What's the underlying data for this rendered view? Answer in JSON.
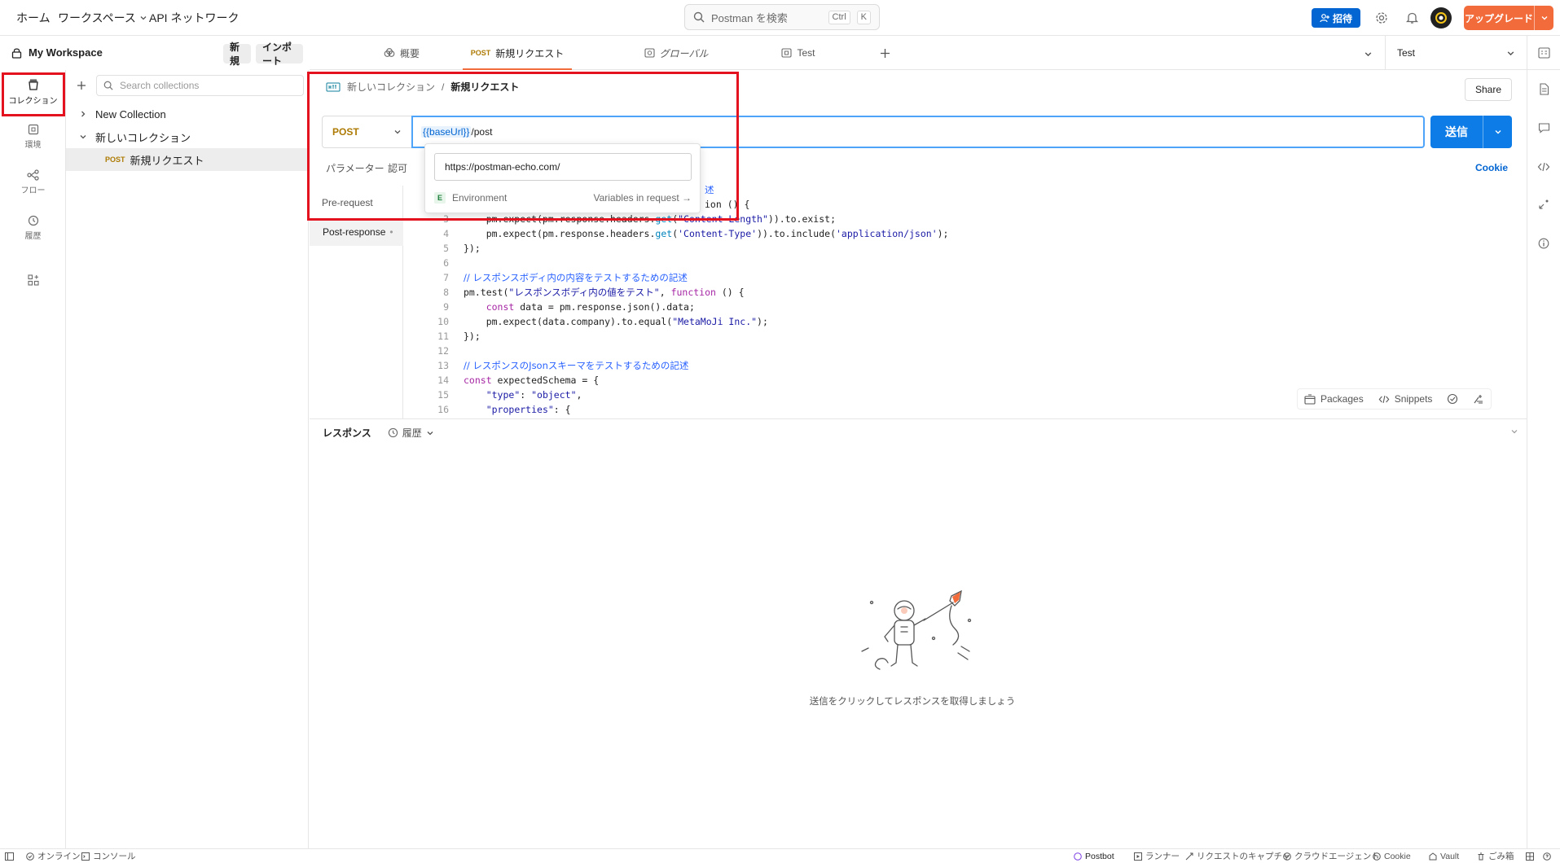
{
  "topbar": {
    "home": "ホーム",
    "workspaces": "ワークスペース",
    "api_network": "API ネットワーク",
    "search_placeholder": "Postman を検索",
    "kbd_ctrl": "Ctrl",
    "kbd_k": "K",
    "invite": "招待",
    "upgrade": "アップグレード"
  },
  "workspace": {
    "name": "My Workspace",
    "new_button": "新規",
    "import_button": "インポート"
  },
  "rail": {
    "items": [
      {
        "label": "コレクション",
        "icon": "collections-icon",
        "active": true
      },
      {
        "label": "環境",
        "icon": "environments-icon"
      },
      {
        "label": "フロー",
        "icon": "flows-icon"
      },
      {
        "label": "履歴",
        "icon": "history-icon"
      },
      {
        "label": "",
        "icon": "add-apps-icon"
      }
    ]
  },
  "collections": {
    "search_placeholder": "Search collections",
    "tree": [
      {
        "label": "New Collection",
        "expanded": false
      },
      {
        "label": "新しいコレクション",
        "expanded": true
      },
      {
        "method": "POST",
        "label": "新規リクエスト",
        "selected": true
      }
    ]
  },
  "tabs": [
    {
      "label": "概要",
      "icon": "overview-icon"
    },
    {
      "method": "POST",
      "label": "新規リクエスト",
      "active": true
    },
    {
      "label": "グローバル",
      "icon": "globals-icon"
    },
    {
      "label": "Test",
      "icon": "environment-tab-icon"
    }
  ],
  "environment_selector": "Test",
  "request": {
    "breadcrumb_parent": "新しいコレクション",
    "breadcrumb_sep": "/",
    "breadcrumb_current": "新規リクエスト",
    "share": "Share",
    "method": "POST",
    "url_var": "{{baseUrl}}",
    "url_path": "/post",
    "send": "送信",
    "tabs": [
      "パラメーター",
      "認可"
    ],
    "cookie": "Cookie"
  },
  "variable_popup": {
    "value": "https://postman-echo.com/",
    "env_badge": "E",
    "env_label": "Environment",
    "link": "Variables in request →"
  },
  "scripts": {
    "items": [
      {
        "label": "Pre-request"
      },
      {
        "label": "Post-response",
        "dot": "•",
        "selected": true
      }
    ],
    "lines": [
      {
        "n": "3",
        "text": "    pm.expect(pm.response.headers.get(\"Content-Length\")).to.exist;"
      },
      {
        "n": "4",
        "text": "    pm.expect(pm.response.headers.get('Content-Type')).to.include('application/json');"
      },
      {
        "n": "5",
        "text": "});"
      },
      {
        "n": "6",
        "text": ""
      },
      {
        "n": "7",
        "text": "// レスポンスボディ内の内容をテストするための記述"
      },
      {
        "n": "8",
        "text": "pm.test(\"レスポンスボディ内の値をテスト\", function () {"
      },
      {
        "n": "9",
        "text": "    const data = pm.response.json().data;"
      },
      {
        "n": "10",
        "text": "    pm.expect(data.company).to.equal(\"MetaMoJi Inc.\");"
      },
      {
        "n": "11",
        "text": "});"
      },
      {
        "n": "12",
        "text": ""
      },
      {
        "n": "13",
        "text": "// レスポンスのJsonスキーマをテストするための記述"
      },
      {
        "n": "14",
        "text": "const expectedSchema = {"
      },
      {
        "n": "15",
        "text": "    \"type\": \"object\","
      },
      {
        "n": "16",
        "text": "    \"properties\": {"
      }
    ],
    "partial_line1_tail": "述",
    "partial_line2_tail": "ion () {",
    "packages": "Packages",
    "snippets": "Snippets"
  },
  "response": {
    "title": "レスポンス",
    "history": "履歴",
    "empty_message": "送信をクリックしてレスポンスを取得しましょう"
  },
  "footer": {
    "online": "オンライン",
    "console": "コンソール",
    "postbot": "Postbot",
    "runner": "ランナー",
    "capture": "リクエストのキャプチャ",
    "cloud_agent": "クラウドエージェント",
    "cookie": "Cookie",
    "vault": "Vault",
    "trash": "ごみ箱"
  },
  "colors": {
    "accent": "#f26b3a",
    "send_blue": "#0d7ce7",
    "post_method": "#ad7a03",
    "highlight_red": "#e4111f"
  }
}
